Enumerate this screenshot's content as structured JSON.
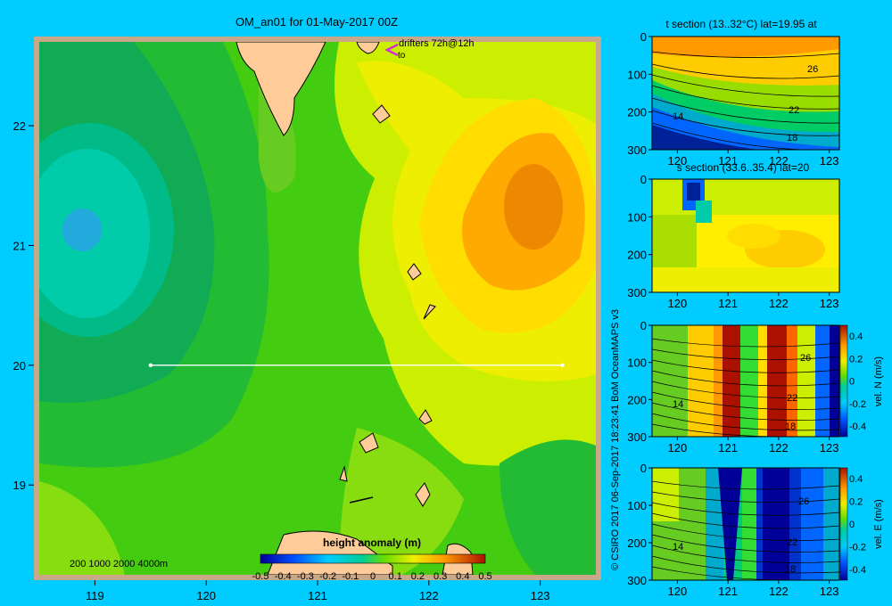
{
  "app": {
    "title": "OM_an01 for 01-May-2017 00Z"
  },
  "credit": "© CSIRO 2017   06-Sep-2017 18:23:41 BoM OceanMAPS v3",
  "colors": {
    "background": "#00ccff",
    "frame": "#c8a888",
    "land": "#ffcc99",
    "island": "#c8aa90",
    "transect": "#ffffff",
    "drifter": "#cc33cc"
  },
  "chart_data": [
    {
      "type": "heatmap",
      "id": "map",
      "title": "OM_an01 for 01-May-2017 00Z",
      "x_ticks": [
        "119",
        "120",
        "121",
        "122",
        "123"
      ],
      "y_ticks": [
        "22",
        "21",
        "20",
        "19"
      ],
      "xlim": [
        118.5,
        123.5
      ],
      "ylim": [
        18.25,
        22.7
      ],
      "legend_label": "height anomaly (m)",
      "colorbar_ticks": [
        "-0.5",
        "-0.4",
        "-0.3",
        "-0.2",
        "-0.1",
        "0",
        "0.1",
        "0.2",
        "0.3",
        "0.4",
        "0.5"
      ],
      "depth_legend": "200  1000  2000  4000m",
      "drifter_label_1": "drifters 72h@12h",
      "drifter_label_2": "to",
      "transect": {
        "lat": 20,
        "lon_start": 119.5,
        "lon_end": 123.2
      },
      "features": [
        {
          "name": "cold eddy",
          "lon": 118.9,
          "lat": 21.05,
          "value": -0.25
        },
        {
          "name": "warm eddy",
          "lon": 122.9,
          "lat": 21.2,
          "value": 0.35
        }
      ]
    },
    {
      "type": "heatmap",
      "id": "t_section",
      "title": "t section (13..32°C) lat=19.95 at",
      "x_ticks": [
        "120",
        "121",
        "122",
        "123"
      ],
      "y_ticks": [
        "0",
        "100",
        "200",
        "300"
      ],
      "xlim": [
        119.5,
        123.2
      ],
      "ylim": [
        0,
        300
      ],
      "contour_labels": [
        "26",
        "22",
        "18",
        "14"
      ]
    },
    {
      "type": "heatmap",
      "id": "s_section",
      "title": "s section (33.6..35.4) lat=20",
      "x_ticks": [
        "120",
        "121",
        "122",
        "123"
      ],
      "y_ticks": [
        "0",
        "100",
        "200",
        "300"
      ],
      "xlim": [
        119.5,
        123.2
      ],
      "ylim": [
        0,
        300
      ]
    },
    {
      "type": "heatmap",
      "id": "vel_n",
      "title": "",
      "x_ticks": [
        "120",
        "121",
        "122",
        "123"
      ],
      "y_ticks": [
        "0",
        "100",
        "200",
        "300"
      ],
      "xlim": [
        119.5,
        123.2
      ],
      "ylim": [
        0,
        300
      ],
      "colorbar_label": "vel. N (m/s)",
      "colorbar_ticks": [
        "0.4",
        "0.2",
        "0",
        "-0.2",
        "-0.4"
      ],
      "contour_labels": [
        "26",
        "22",
        "18",
        "14"
      ],
      "jets": [
        {
          "lon": 120.9,
          "sign": 1
        },
        {
          "lon": 121.2,
          "sign": -1
        },
        {
          "lon": 121.75,
          "sign": 1
        },
        {
          "lon": 122.3,
          "sign": -1
        }
      ]
    },
    {
      "type": "heatmap",
      "id": "vel_e",
      "title": "",
      "x_ticks": [
        "120",
        "121",
        "122",
        "123"
      ],
      "y_ticks": [
        "0",
        "100",
        "200",
        "300"
      ],
      "xlim": [
        119.5,
        123.2
      ],
      "ylim": [
        0,
        300
      ],
      "colorbar_label": "vel. E (m/s)",
      "colorbar_ticks": [
        "0.4",
        "0.2",
        "0",
        "-0.2",
        "-0.4"
      ],
      "contour_labels": [
        "26",
        "22",
        "18",
        "14"
      ]
    }
  ]
}
